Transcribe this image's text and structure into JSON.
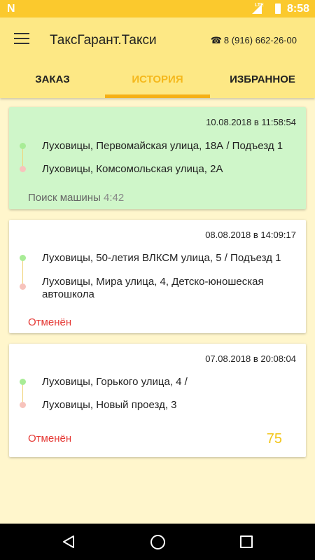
{
  "status_bar": {
    "network_logo": "N",
    "network_type": "LTE",
    "time": "8:58"
  },
  "app_bar": {
    "title": "ТаксГарант.Такси",
    "phone_icon": "☎",
    "phone": "8 (916) 662-26-00"
  },
  "tabs": [
    {
      "label": "ЗАКАЗ",
      "active": false
    },
    {
      "label": "ИСТОРИЯ",
      "active": true
    },
    {
      "label": "ИЗБРАННОЕ",
      "active": false
    }
  ],
  "orders": [
    {
      "date": "10.08.2018 в 11:58:54",
      "from": "Луховицы, Первомайская улица, 18А / Подъезд 1",
      "to": "Луховицы, Комсомольская улица, 2А",
      "status": "Поиск машины",
      "timer": "4:42",
      "price": ""
    },
    {
      "date": "08.08.2018 в 14:09:17",
      "from": "Луховицы, 50-летия ВЛКСМ улица, 5 / Подъезд 1",
      "to": "Луховицы, Мира улица, 4, Детско-юношеская автошкола",
      "status": "Отменён",
      "price": ""
    },
    {
      "date": "07.08.2018 в 20:08:04",
      "from": "Луховицы, Горького улица, 4 /",
      "to": "Луховицы, Новый проезд, 3",
      "status": "Отменён",
      "price": "75"
    }
  ],
  "colors": {
    "accent": "#f5b016",
    "app_bar": "#fde885",
    "status_bar": "#fbc92d",
    "active_card": "#cff6c9",
    "cancelled": "#e53935",
    "price": "#f2c519"
  }
}
